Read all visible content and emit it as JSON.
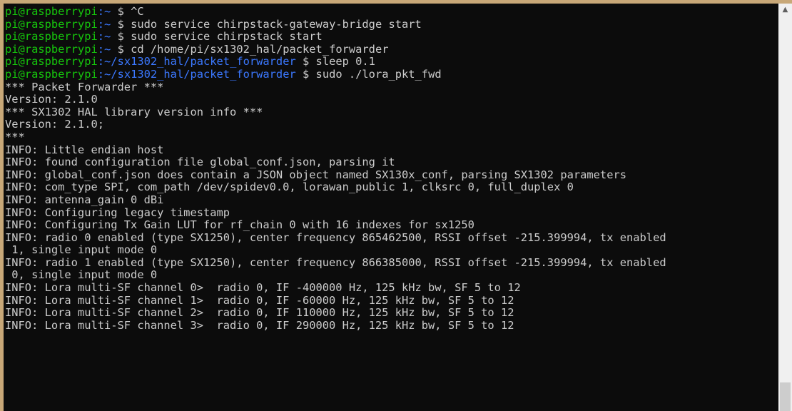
{
  "terminal": {
    "prompt_user": "pi@raspberrypi",
    "lines": [
      {
        "kind": "prompt",
        "path": "~",
        "command": "^C"
      },
      {
        "kind": "prompt",
        "path": "~",
        "command": "sudo service chirpstack-gateway-bridge start"
      },
      {
        "kind": "prompt",
        "path": "~",
        "command": "sudo service chirpstack start"
      },
      {
        "kind": "prompt",
        "path": "~",
        "command": "cd /home/pi/sx1302_hal/packet_forwarder"
      },
      {
        "kind": "prompt",
        "path": "~/sx1302_hal/packet_forwarder",
        "command": "sleep 0.1"
      },
      {
        "kind": "prompt",
        "path": "~/sx1302_hal/packet_forwarder",
        "command": "sudo ./lora_pkt_fwd"
      },
      {
        "kind": "output",
        "text": "*** Packet Forwarder ***"
      },
      {
        "kind": "output",
        "text": "Version: 2.1.0"
      },
      {
        "kind": "output",
        "text": "*** SX1302 HAL library version info ***"
      },
      {
        "kind": "output",
        "text": "Version: 2.1.0;"
      },
      {
        "kind": "output",
        "text": "***"
      },
      {
        "kind": "output",
        "text": "INFO: Little endian host"
      },
      {
        "kind": "output",
        "text": "INFO: found configuration file global_conf.json, parsing it"
      },
      {
        "kind": "output",
        "text": "INFO: global_conf.json does contain a JSON object named SX130x_conf, parsing SX1302 parameters"
      },
      {
        "kind": "output",
        "text": "INFO: com_type SPI, com_path /dev/spidev0.0, lorawan_public 1, clksrc 0, full_duplex 0"
      },
      {
        "kind": "output",
        "text": "INFO: antenna_gain 0 dBi"
      },
      {
        "kind": "output",
        "text": "INFO: Configuring legacy timestamp"
      },
      {
        "kind": "output",
        "text": "INFO: Configuring Tx Gain LUT for rf_chain 0 with 16 indexes for sx1250"
      },
      {
        "kind": "output",
        "text": "INFO: radio 0 enabled (type SX1250), center frequency 865462500, RSSI offset -215.399994, tx enabled"
      },
      {
        "kind": "output",
        "text": " 1, single input mode 0"
      },
      {
        "kind": "output",
        "text": "INFO: radio 1 enabled (type SX1250), center frequency 866385000, RSSI offset -215.399994, tx enabled"
      },
      {
        "kind": "output",
        "text": " 0, single input mode 0"
      },
      {
        "kind": "output",
        "text": "INFO: Lora multi-SF channel 0>  radio 0, IF -400000 Hz, 125 kHz bw, SF 5 to 12"
      },
      {
        "kind": "output",
        "text": "INFO: Lora multi-SF channel 1>  radio 0, IF -60000 Hz, 125 kHz bw, SF 5 to 12"
      },
      {
        "kind": "output",
        "text": "INFO: Lora multi-SF channel 2>  radio 0, IF 110000 Hz, 125 kHz bw, SF 5 to 12"
      },
      {
        "kind": "output",
        "text": "INFO: Lora multi-SF channel 3>  radio 0, IF 290000 Hz, 125 kHz bw, SF 5 to 12"
      }
    ]
  },
  "scrollbar": {
    "up_arrow_icon": "chevron-up-icon"
  },
  "colors": {
    "background": "#0c0c0c",
    "text": "#cccccc",
    "prompt_user": "#16c60c",
    "prompt_path": "#3b78ff"
  }
}
